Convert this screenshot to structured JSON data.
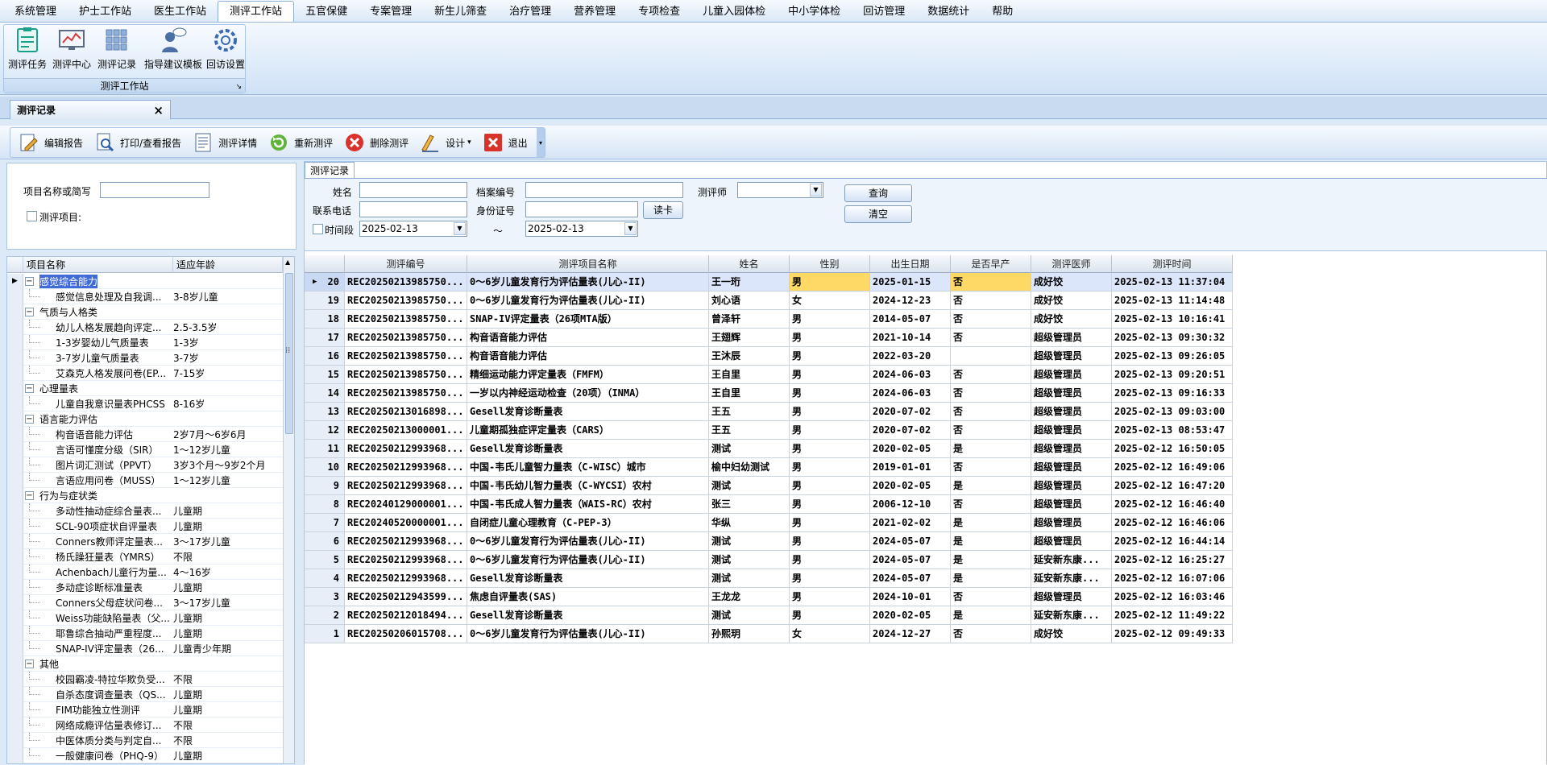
{
  "menubar": [
    "系统管理",
    "护士工作站",
    "医生工作站",
    "测评工作站",
    "五官保健",
    "专案管理",
    "新生儿筛查",
    "治疗管理",
    "营养管理",
    "专项检查",
    "儿童入园体检",
    "中小学体检",
    "回访管理",
    "数据统计",
    "帮助"
  ],
  "menubar_active_index": 3,
  "ribbon": {
    "buttons": [
      {
        "label": "测评任务",
        "icon": "task-list-icon"
      },
      {
        "label": "测评中心",
        "icon": "chart-monitor-icon"
      },
      {
        "label": "测评记录",
        "icon": "grid-records-icon"
      },
      {
        "label": "指导建议模板",
        "icon": "advisor-person-icon"
      },
      {
        "label": "回访设置",
        "icon": "gear-icon"
      }
    ],
    "group_label": "测评工作站"
  },
  "doc_tab": {
    "label": "测评记录",
    "close": "×"
  },
  "toolbar": [
    {
      "label": "编辑报告",
      "icon": "edit-report-icon"
    },
    {
      "label": "打印/查看报告",
      "icon": "print-preview-icon"
    },
    {
      "label": "测评详情",
      "icon": "details-doc-icon"
    },
    {
      "label": "重新测评",
      "icon": "refresh-icon"
    },
    {
      "label": "删除测评",
      "icon": "delete-icon"
    },
    {
      "label": "设计",
      "icon": "design-icon",
      "dropdown": "▾"
    },
    {
      "label": "退出",
      "icon": "exit-icon"
    }
  ],
  "left_search": {
    "name_label": "项目名称或简写",
    "name_value": "",
    "project_label": "测评项目:"
  },
  "tree": {
    "headers": [
      "项目名称",
      "适应年龄"
    ],
    "rows": [
      {
        "level": 0,
        "name": "感觉综合能力",
        "age": "",
        "expander": "−",
        "selected": true
      },
      {
        "level": 1,
        "name": "感觉信息处理及自我调...",
        "age": "3-8岁儿童"
      },
      {
        "level": 0,
        "name": "气质与人格类",
        "age": "",
        "expander": "−"
      },
      {
        "level": 1,
        "name": "幼儿人格发展趋向评定...",
        "age": "2.5-3.5岁"
      },
      {
        "level": 1,
        "name": "1-3岁婴幼儿气质量表",
        "age": "1-3岁"
      },
      {
        "level": 1,
        "name": "3-7岁儿童气质量表",
        "age": "3-7岁"
      },
      {
        "level": 1,
        "name": "艾森克人格发展问卷(EP...",
        "age": "7-15岁"
      },
      {
        "level": 0,
        "name": "心理量表",
        "age": "",
        "expander": "−"
      },
      {
        "level": 1,
        "name": "儿童自我意识量表PHCSS",
        "age": "8-16岁"
      },
      {
        "level": 0,
        "name": "语言能力评估",
        "age": "",
        "expander": "−"
      },
      {
        "level": 1,
        "name": "构音语音能力评估",
        "age": "2岁7月～6岁6月"
      },
      {
        "level": 1,
        "name": "言语可懂度分级（SIR）",
        "age": "1～12岁儿童"
      },
      {
        "level": 1,
        "name": "图片词汇测试（PPVT）",
        "age": "3岁3个月～9岁2个月"
      },
      {
        "level": 1,
        "name": "言语应用问卷（MUSS）",
        "age": "1～12岁儿童"
      },
      {
        "level": 0,
        "name": "行为与症状类",
        "age": "",
        "expander": "−"
      },
      {
        "level": 1,
        "name": "多动性抽动症综合量表...",
        "age": "儿童期"
      },
      {
        "level": 1,
        "name": "SCL-90项症状自评量表",
        "age": "儿童期"
      },
      {
        "level": 1,
        "name": "Conners教师评定量表...",
        "age": "3～17岁儿童"
      },
      {
        "level": 1,
        "name": "杨氏躁狂量表（YMRS）",
        "age": "不限"
      },
      {
        "level": 1,
        "name": "Achenbach儿童行为量...",
        "age": "4～16岁"
      },
      {
        "level": 1,
        "name": "多动症诊断标准量表",
        "age": "儿童期"
      },
      {
        "level": 1,
        "name": "Conners父母症状问卷...",
        "age": "3～17岁儿童"
      },
      {
        "level": 1,
        "name": "Weiss功能缺陷量表（父...",
        "age": "儿童期"
      },
      {
        "level": 1,
        "name": "耶鲁综合抽动严重程度...",
        "age": "儿童期"
      },
      {
        "level": 1,
        "name": "SNAP-IV评定量表（26...",
        "age": "儿童青少年期"
      },
      {
        "level": 0,
        "name": "其他",
        "age": "",
        "expander": "−"
      },
      {
        "level": 1,
        "name": "校园霸凌-特拉华欺负受...",
        "age": "不限"
      },
      {
        "level": 1,
        "name": "自杀态度调查量表（QS...",
        "age": "儿童期"
      },
      {
        "level": 1,
        "name": "FIM功能独立性测评",
        "age": "儿童期"
      },
      {
        "level": 1,
        "name": "网络成瘾评估量表修订...",
        "age": "不限"
      },
      {
        "level": 1,
        "name": "中医体质分类与判定自...",
        "age": "不限"
      },
      {
        "level": 1,
        "name": "一般健康问卷（PHQ-9）",
        "age": "儿童期"
      }
    ]
  },
  "right": {
    "tab": "测评记录",
    "query": {
      "name_label": "姓名",
      "file_no_label": "档案编号",
      "assessor_label": "测评师",
      "phone_label": "联系电话",
      "id_label": "身份证号",
      "read_card": "读卡",
      "period_label": "时间段",
      "date_from": "2025-02-13",
      "tilde": "～",
      "date_to": "2025-02-13",
      "query_btn": "查询",
      "clear_btn": "清空"
    },
    "grid": {
      "headers": [
        "",
        "测评编号",
        "测评项目名称",
        "姓名",
        "性别",
        "出生日期",
        "是否早产",
        "测评医师",
        "测评时间"
      ],
      "rows": [
        [
          "20",
          "REC20250213985750...",
          "0～6岁儿童发育行为评估量表(儿心-II)",
          "王一珩",
          "男",
          "2025-01-15",
          "否",
          "成好饺",
          "2025-02-13 11:37:04"
        ],
        [
          "19",
          "REC20250213985750...",
          "0～6岁儿童发育行为评估量表(儿心-II)",
          "刘心语",
          "女",
          "2024-12-23",
          "否",
          "成好饺",
          "2025-02-13 11:14:48"
        ],
        [
          "18",
          "REC20250213985750...",
          "SNAP-IV评定量表（26项MTA版）",
          "曾泽轩",
          "男",
          "2014-05-07",
          "否",
          "成好饺",
          "2025-02-13 10:16:41"
        ],
        [
          "17",
          "REC20250213985750...",
          "构音语音能力评估",
          "王翅辉",
          "男",
          "2021-10-14",
          "否",
          "超级管理员",
          "2025-02-13 09:30:32"
        ],
        [
          "16",
          "REC20250213985750...",
          "构音语音能力评估",
          "王沐辰",
          "男",
          "2022-03-20",
          "",
          "超级管理员",
          "2025-02-13 09:26:05"
        ],
        [
          "15",
          "REC20250213985750...",
          "精细运动能力评定量表（FMFM）",
          "王自里",
          "男",
          "2024-06-03",
          "否",
          "超级管理员",
          "2025-02-13 09:20:51"
        ],
        [
          "14",
          "REC20250213985750...",
          "一岁以内神经运动检查（20项）（INMA）",
          "王自里",
          "男",
          "2024-06-03",
          "否",
          "超级管理员",
          "2025-02-13 09:16:33"
        ],
        [
          "13",
          "REC20250213016898...",
          "Gesell发育诊断量表",
          "王五",
          "男",
          "2020-07-02",
          "否",
          "超级管理员",
          "2025-02-13 09:03:00"
        ],
        [
          "12",
          "REC20250213000001...",
          "儿童期孤独症评定量表（CARS）",
          "王五",
          "男",
          "2020-07-02",
          "否",
          "超级管理员",
          "2025-02-13 08:53:47"
        ],
        [
          "11",
          "REC20250212993968...",
          "Gesell发育诊断量表",
          "测试",
          "男",
          "2020-02-05",
          "是",
          "超级管理员",
          "2025-02-12 16:50:05"
        ],
        [
          "10",
          "REC20250212993968...",
          "中国-韦氏儿童智力量表（C-WISC）城市",
          "榆中妇幼测试",
          "男",
          "2019-01-01",
          "否",
          "超级管理员",
          "2025-02-12 16:49:06"
        ],
        [
          "9",
          "REC20250212993968...",
          "中国-韦氏幼儿智力量表（C-WYCSI）农村",
          "测试",
          "男",
          "2020-02-05",
          "是",
          "超级管理员",
          "2025-02-12 16:47:20"
        ],
        [
          "8",
          "REC20240129000001...",
          "中国-韦氏成人智力量表（WAIS-RC）农村",
          "张三",
          "男",
          "2006-12-10",
          "否",
          "超级管理员",
          "2025-02-12 16:46:40"
        ],
        [
          "7",
          "REC20240520000001...",
          "自闭症儿童心理教育（C-PEP-3）",
          "华纵",
          "男",
          "2021-02-02",
          "是",
          "超级管理员",
          "2025-02-12 16:46:06"
        ],
        [
          "6",
          "REC20250212993968...",
          "0～6岁儿童发育行为评估量表(儿心-II)",
          "测试",
          "男",
          "2024-05-07",
          "是",
          "超级管理员",
          "2025-02-12 16:44:14"
        ],
        [
          "5",
          "REC20250212993968...",
          "0～6岁儿童发育行为评估量表(儿心-II)",
          "测试",
          "男",
          "2024-05-07",
          "是",
          "延安新东康...",
          "2025-02-12 16:25:27"
        ],
        [
          "4",
          "REC20250212993968...",
          "Gesell发育诊断量表",
          "测试",
          "男",
          "2024-05-07",
          "是",
          "延安新东康...",
          "2025-02-12 16:07:06"
        ],
        [
          "3",
          "REC20250212943599...",
          "焦虑自评量表(SAS)",
          "王龙龙",
          "男",
          "2024-10-01",
          "否",
          "超级管理员",
          "2025-02-12 16:03:46"
        ],
        [
          "2",
          "REC20250212018494...",
          "Gesell发育诊断量表",
          "测试",
          "男",
          "2020-02-05",
          "是",
          "延安新东康...",
          "2025-02-12 11:49:22"
        ],
        [
          "1",
          "REC20250206015708...",
          "0～6岁儿童发育行为评估量表(儿心-II)",
          "孙熙玥",
          "女",
          "2024-12-27",
          "否",
          "成好饺",
          "2025-02-12 09:49:33"
        ]
      ],
      "current_row_marker": "▶"
    }
  },
  "colors": {
    "accent": "#3f6ad8",
    "highlight": "#ffd966",
    "selected_row": "#dbe6fb"
  }
}
